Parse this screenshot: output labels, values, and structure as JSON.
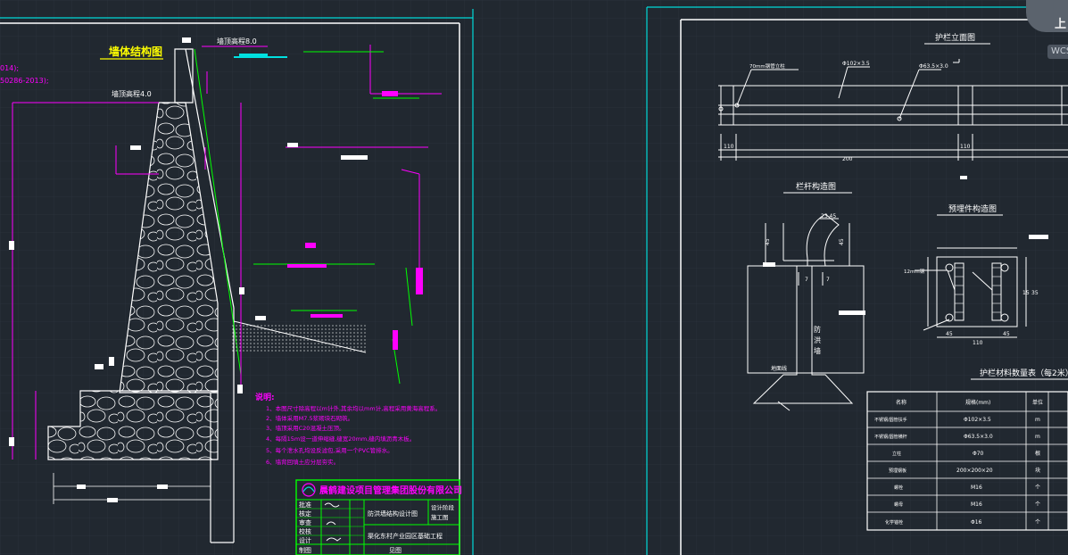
{
  "left_sheet": {
    "main_title": "墙体结构图",
    "note_line1": "014);",
    "note_line2": "50286-2013);",
    "top_elev": "墙顶高程8.0",
    "mid_elev": "墙顶高程4.0",
    "notes_title": "说明:",
    "notes": [
      "1、本图尺寸除高程以m计外,其余均以mm计,高程采用黄海高程系。",
      "2、墙体采用M7.5浆砌块石砌筑。",
      "3、墙顶采用C20混凝土压顶。",
      "4、每隔15m设一道伸缩缝,缝宽20mm,缝内填沥青木板。",
      "5、每个泄水孔均设反滤包,采用一个PVC管排水。",
      "6、墙背回填土应分层夯实。"
    ],
    "title_block": {
      "company": "晨鹤建设项目管理集团股份有限公司",
      "project": "防洪墙结构设计图",
      "stage_label1": "设计阶段",
      "stage_label2": "施工图",
      "drawing_name": "渠化东村产业园区基础工程",
      "roles": [
        "批准",
        "核定",
        "审查",
        "校核",
        "设计",
        "制图"
      ],
      "footer": "见图"
    }
  },
  "right_sheet": {
    "elevation_title": "护栏立面图",
    "label_a": "70mm钢管立柱",
    "label_b": "Φ102×3.5",
    "label_c": "Φ63.5×3.0",
    "dims": [
      "110",
      "200",
      "110"
    ],
    "post_title": "栏杆构造图",
    "wall_text": [
      "防",
      "洪",
      "墙"
    ],
    "ground_label": "地面线",
    "embed_title": "预埋件构造图",
    "embed_left_label": "12mm钢",
    "embed_dims": [
      "45",
      "110",
      "45",
      "15",
      "35"
    ],
    "table_title": "护栏材料数量表（每2米）",
    "table_headers": [
      "名称",
      "规格(mm)",
      "单位"
    ],
    "table_rows": [
      [
        "不锈钢/圆管扶手",
        "Φ102×3.5",
        "m"
      ],
      [
        "不锈钢/圆管横杆",
        "Φ63.5×3.0",
        "m"
      ],
      [
        "立柱",
        "Φ70",
        "根"
      ],
      [
        "预埋钢板",
        "200×200×20",
        "块"
      ],
      [
        "螺栓",
        "M16",
        "个"
      ],
      [
        "螺母",
        "M16",
        "个"
      ],
      [
        "化学锚栓",
        "Φ16",
        "个"
      ]
    ]
  },
  "ui": {
    "wcs_label": "WCS",
    "viewcube_label": "上"
  },
  "colors": {
    "background": "#212830",
    "frame": "#ffffff",
    "cyan": "#00d8d8",
    "magenta": "#ff00ff",
    "green": "#00ff00",
    "grid": "#2a323b"
  }
}
